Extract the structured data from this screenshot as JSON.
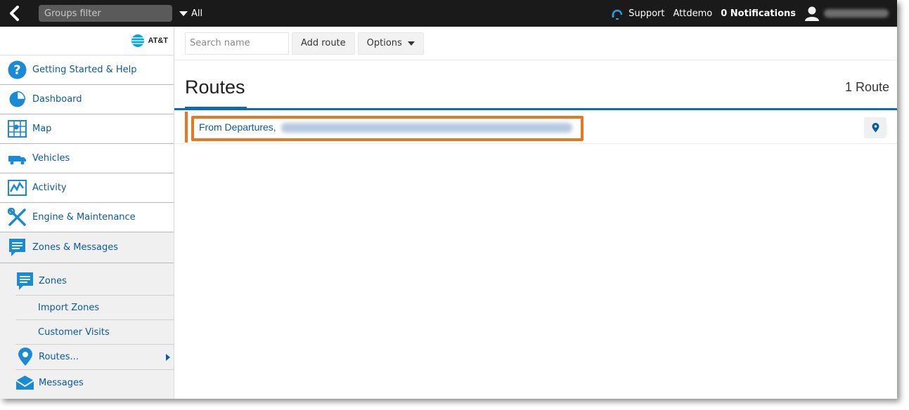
{
  "topbar": {
    "groups_filter_placeholder": "Groups filter",
    "groups_dropdown_value": "All",
    "support_label": "Support",
    "account_label": "Attdemo",
    "notifications_label": "0 Notifications"
  },
  "brand": {
    "name": "AT&T"
  },
  "sidebar": {
    "items": [
      {
        "label": "Getting Started & Help",
        "icon": "help-icon"
      },
      {
        "label": "Dashboard",
        "icon": "dashboard-icon"
      },
      {
        "label": "Map",
        "icon": "map-icon"
      },
      {
        "label": "Vehicles",
        "icon": "vehicle-icon"
      },
      {
        "label": "Activity",
        "icon": "activity-icon"
      },
      {
        "label": "Engine & Maintenance",
        "icon": "wrench-icon"
      },
      {
        "label": "Zones & Messages",
        "icon": "message-icon"
      }
    ],
    "sub_items": [
      {
        "label": "Zones",
        "icon": "zones-icon"
      },
      {
        "label": "Import Zones"
      },
      {
        "label": "Customer Visits"
      },
      {
        "label": "Routes...",
        "icon": "pin-icon"
      },
      {
        "label": "Messages",
        "icon": "envelope-icon"
      }
    ]
  },
  "toolbar": {
    "search_placeholder": "Search name",
    "add_route_label": "Add route",
    "options_label": "Options"
  },
  "main": {
    "title": "Routes",
    "count": "1 Route",
    "routes": [
      {
        "name": "From Departures,"
      }
    ]
  },
  "colors": {
    "accent_blue": "#0d6cb0",
    "link_blue": "#0b5aa0",
    "highlight_orange": "#e87722",
    "topbar_bg": "#1a1a1a"
  }
}
